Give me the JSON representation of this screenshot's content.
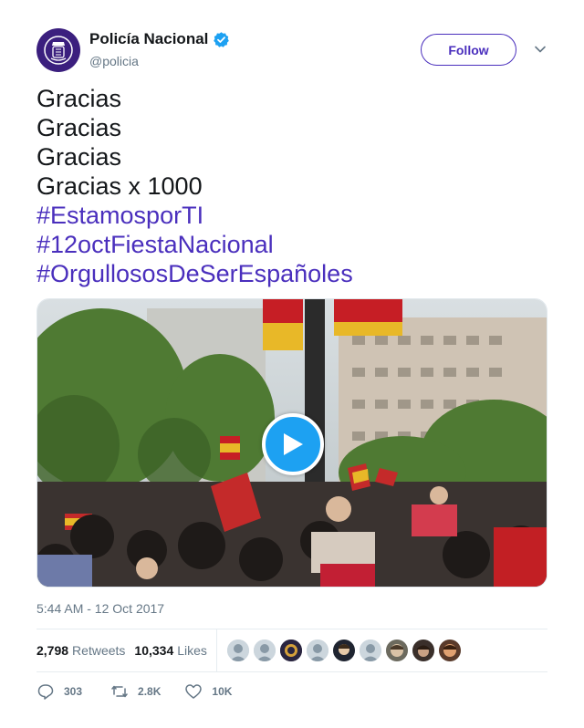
{
  "account": {
    "display_name": "Policía Nacional",
    "handle": "@policia",
    "verified": true,
    "avatar_color": "#3b1f7e"
  },
  "follow_button": {
    "label": "Follow",
    "color": "#4a2fbd"
  },
  "menu_icon": "chevron-down-icon",
  "tweet": {
    "lines": [
      "Gracias",
      "Gracias",
      "Gracias",
      "Gracias x 1000"
    ],
    "hashtags": [
      "#EstamosporTI",
      "#12octFiestaNacional",
      "#OrgullososDeSerEspañoles"
    ],
    "hashtag_color": "#4a2fbd"
  },
  "media": {
    "type": "video",
    "play_icon": "play-icon",
    "accent": "#1da1f2"
  },
  "timestamp": "5:44 AM - 12 Oct 2017",
  "stats": {
    "retweets_count": "2,798",
    "retweets_label": "Retweets",
    "likes_count": "10,334",
    "likes_label": "Likes"
  },
  "actions": {
    "reply_count": "303",
    "retweet_count": "2.8K",
    "like_count": "10K"
  }
}
